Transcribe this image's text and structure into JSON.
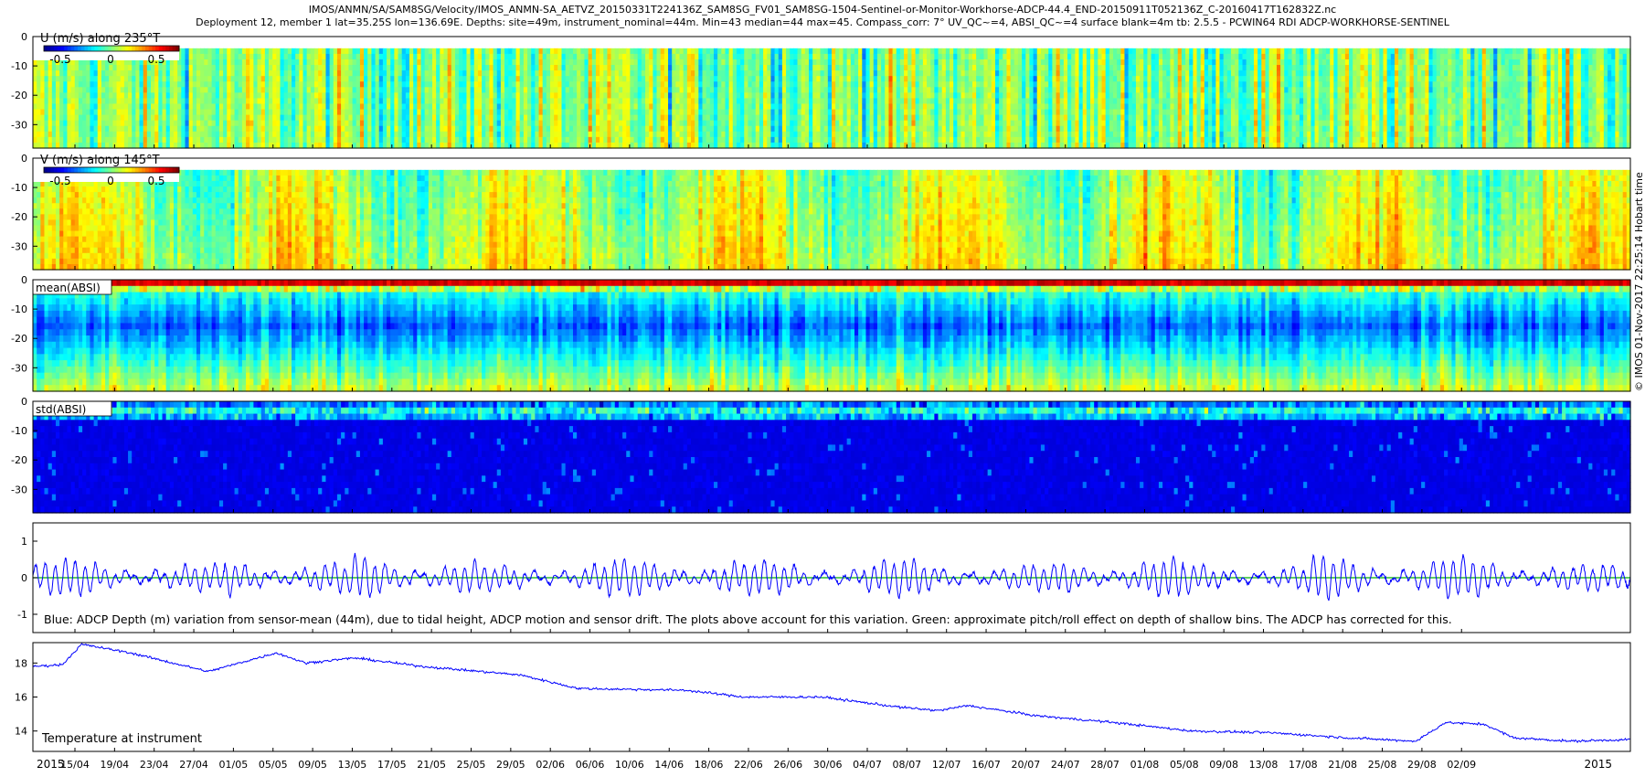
{
  "header": {
    "line1": "IMOS/ANMN/SA/SAM8SG/Velocity/IMOS_ANMN-SA_AETVZ_20150331T224136Z_SAM8SG_FV01_SAM8SG-1504-Sentinel-or-Monitor-Workhorse-ADCP-44.4_END-20150911T052136Z_C-20160417T162832Z.nc",
    "line2": "Deployment 12, member 1 lat=35.25S lon=136.69E. Depths: site=49m, instrument_nominal=44m. Min=43 median=44 max=45. Compass_corr: 7° UV_QC~=4, ABSI_QC~=4 surface blank=4m tb: 2.5.5 - PCWIN64 RDI ADCP-WORKHORSE-SENTINEL"
  },
  "stamp": "© IMOS 01-Nov-2017 22:25:14 Hobart time",
  "colors": {
    "jet": [
      "#00008f",
      "#0000ff",
      "#0080ff",
      "#00ffff",
      "#80ff80",
      "#ffff00",
      "#ff8000",
      "#ff0000",
      "#800000"
    ],
    "line_blue": "#0000ff",
    "line_green": "#00b000"
  },
  "chart_data": [
    {
      "type": "heatmap",
      "label": "U (m/s) along 235°T",
      "colorbar_ticks": [
        "-0.5",
        "0",
        "0.5"
      ],
      "yticks": [
        "0",
        "-10",
        "-20",
        "-30"
      ],
      "clim": [
        -0.7,
        0.7
      ],
      "note": "velocity field, depth 0 to -38 m"
    },
    {
      "type": "heatmap",
      "label": "V (m/s) along 145°T",
      "colorbar_ticks": [
        "-0.5",
        "0",
        "0.5"
      ],
      "yticks": [
        "0",
        "-10",
        "-20",
        "-30"
      ],
      "clim": [
        -0.7,
        0.7
      ]
    },
    {
      "type": "heatmap",
      "label": "mean(ABSI)",
      "yticks": [
        "0",
        "-10",
        "-20",
        "-30"
      ]
    },
    {
      "type": "heatmap",
      "label": "std(ABSI)",
      "yticks": [
        "0",
        "-10",
        "-20",
        "-30"
      ]
    },
    {
      "type": "line",
      "yticks": [
        "1",
        "0",
        "-1"
      ],
      "ylim": [
        -1.5,
        1.5
      ],
      "caption": "Blue: ADCP Depth (m) variation from sensor-mean (44m), due to tidal height, ADCP motion and sensor drift. The plots above account for this variation. Green: approximate pitch/roll effect on depth of shallow bins. The ADCP has corrected for this.",
      "series": [
        {
          "color": "#0000ff",
          "amplitude_by_week": [
            0.45,
            0.4,
            0.3,
            0.5,
            0.35,
            0.6,
            0.4,
            0.3,
            0.4,
            0.45,
            0.5,
            0.4,
            0.3,
            0.45,
            0.35,
            0.3,
            0.45,
            0.5,
            0.35,
            0.3,
            0.55,
            0.4,
            0.5,
            0.4,
            0.3
          ]
        },
        {
          "color": "#00b000",
          "values_constant": 0
        }
      ]
    },
    {
      "type": "line",
      "label": "Temperature at instrument",
      "yticks": [
        "18",
        "16",
        "14"
      ],
      "ylim": [
        12.8,
        19.2
      ],
      "x": [
        "2015-03-31",
        "2015-04-03",
        "2015-04-05",
        "2015-04-10",
        "2015-04-18",
        "2015-04-25",
        "2015-04-28",
        "2015-05-03",
        "2015-05-10",
        "2015-05-20",
        "2015-05-26",
        "2015-06-06",
        "2015-06-12",
        "2015-06-20",
        "2015-06-28",
        "2015-07-02",
        "2015-07-05",
        "2015-07-12",
        "2015-07-20",
        "2015-07-28",
        "2015-08-05",
        "2015-08-13",
        "2015-08-20",
        "2015-08-23",
        "2015-08-27",
        "2015-08-30",
        "2015-09-05",
        "2015-09-11"
      ],
      "y": [
        17.8,
        17.9,
        19.1,
        18.6,
        17.5,
        18.6,
        18.0,
        18.3,
        17.8,
        17.3,
        16.5,
        16.4,
        16.0,
        16.0,
        15.4,
        15.2,
        15.5,
        14.9,
        14.5,
        14.0,
        13.9,
        13.6,
        13.4,
        14.5,
        14.4,
        13.6,
        13.4,
        13.5
      ]
    }
  ],
  "xaxis": {
    "year_start": "2015",
    "year_end": "2015",
    "ticks": [
      "15/04",
      "19/04",
      "23/04",
      "27/04",
      "01/05",
      "05/05",
      "09/05",
      "13/05",
      "17/05",
      "21/05",
      "25/05",
      "29/05",
      "02/06",
      "06/06",
      "10/06",
      "14/06",
      "18/06",
      "22/06",
      "26/06",
      "30/06",
      "04/07",
      "08/07",
      "12/07",
      "16/07",
      "20/07",
      "24/07",
      "28/07",
      "01/08",
      "05/08",
      "09/08",
      "13/08",
      "17/08",
      "21/08",
      "25/08",
      "29/08",
      "02/09"
    ]
  }
}
